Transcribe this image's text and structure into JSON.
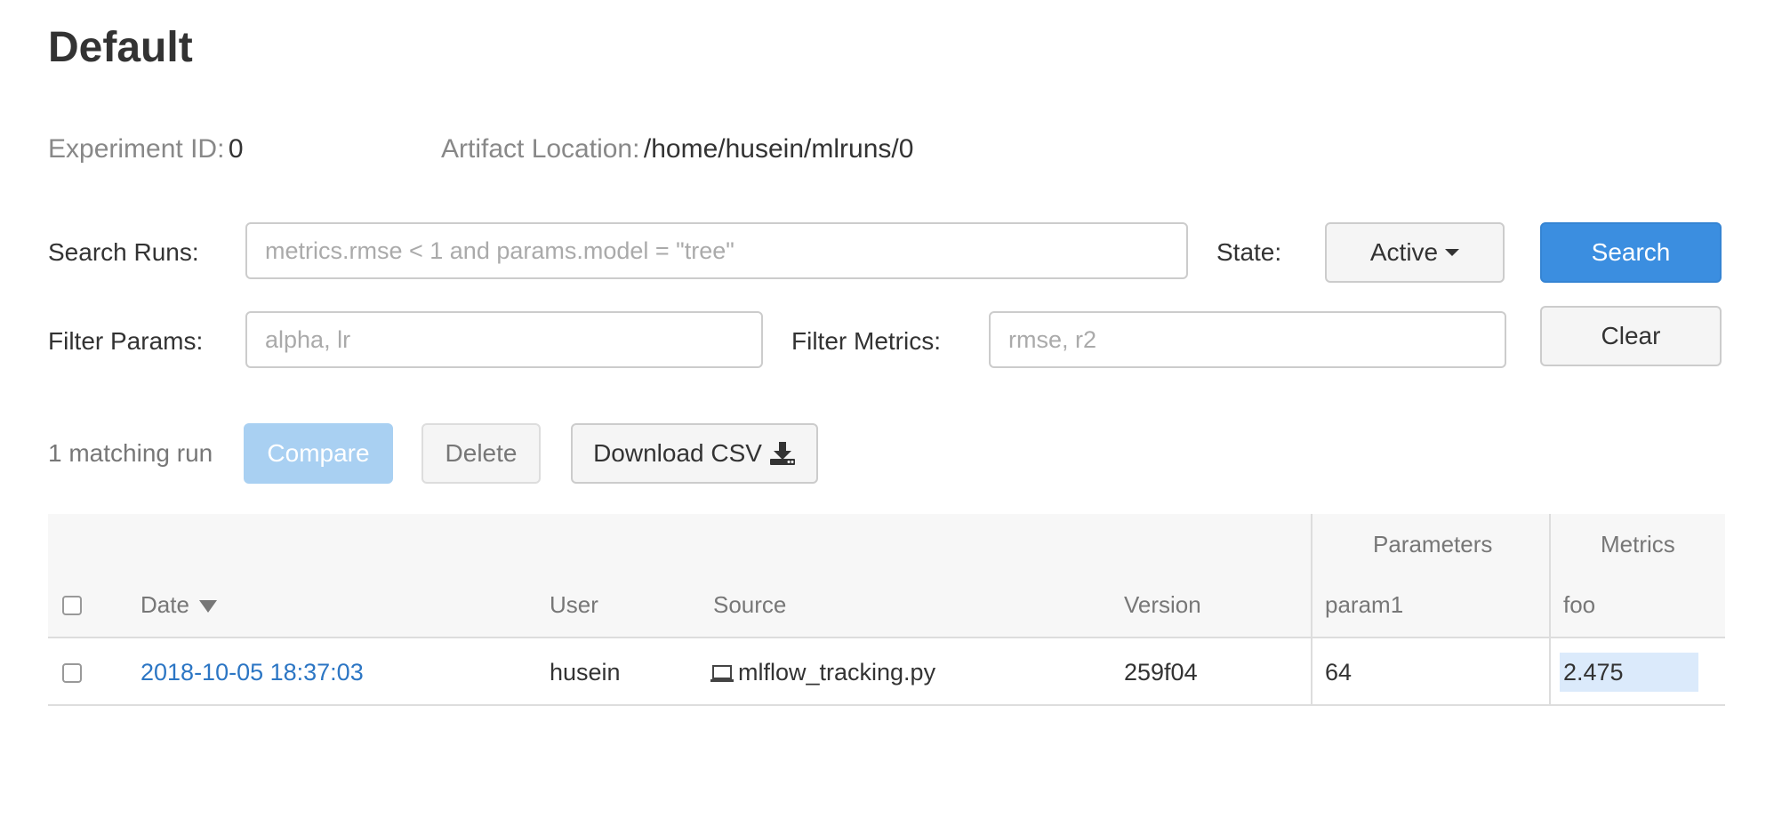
{
  "experiment": {
    "title": "Default",
    "id_label": "Experiment ID:",
    "id_value": "0",
    "artifact_label": "Artifact Location:",
    "artifact_value": "/home/husein/mlruns/0"
  },
  "search": {
    "runs_label": "Search Runs:",
    "runs_placeholder": "metrics.rmse < 1 and params.model = \"tree\"",
    "state_label": "State:",
    "state_value": "Active",
    "search_button": "Search",
    "params_label": "Filter Params:",
    "params_placeholder": "alpha, lr",
    "metrics_label": "Filter Metrics:",
    "metrics_placeholder": "rmse, r2",
    "clear_button": "Clear"
  },
  "actions": {
    "match_count": "1 matching run",
    "compare": "Compare",
    "delete": "Delete",
    "download_csv": "Download CSV"
  },
  "table": {
    "group_headers": {
      "parameters": "Parameters",
      "metrics": "Metrics"
    },
    "columns": {
      "date": "Date",
      "user": "User",
      "source": "Source",
      "version": "Version",
      "param1": "param1",
      "foo": "foo"
    },
    "rows": [
      {
        "date": "2018-10-05 18:37:03",
        "user": "husein",
        "source": "mlflow_tracking.py",
        "version": "259f04",
        "param1": "64",
        "foo": "2.475"
      }
    ]
  },
  "icons": {
    "date_sort": "sort-desc-icon",
    "source": "laptop-icon",
    "download": "download-icon",
    "state_dropdown": "caret-down-icon"
  },
  "colors": {
    "primary": "#3b8ee0",
    "link": "#2c76c4",
    "metric_highlight": "#dbeafb"
  }
}
